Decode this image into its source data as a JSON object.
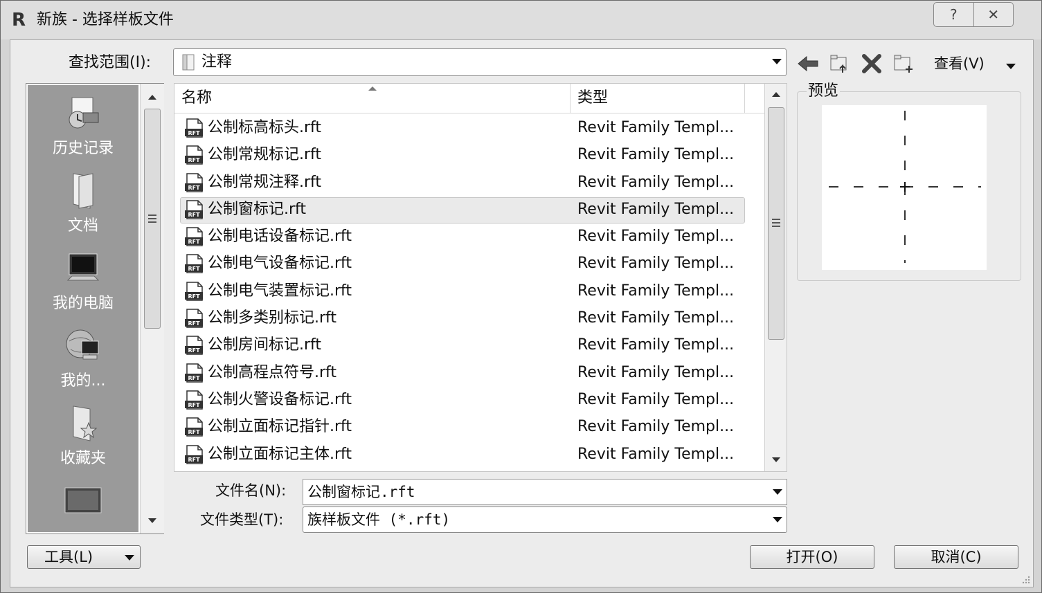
{
  "window": {
    "title": "新族 - 选择样板文件",
    "app_icon": "R",
    "help_glyph": "?",
    "close_glyph": "✕"
  },
  "lookin": {
    "label": "查找范围(I):",
    "value": "注释"
  },
  "toolbar": {
    "view_label": "查看(V)",
    "icons": [
      "back-arrow-icon",
      "up-folder-icon",
      "delete-icon",
      "new-folder-icon"
    ]
  },
  "places": [
    {
      "label": "历史记录",
      "icon": "history-icon"
    },
    {
      "label": "文档",
      "icon": "documents-icon"
    },
    {
      "label": "我的电脑",
      "icon": "computer-icon"
    },
    {
      "label": "我的...",
      "icon": "network-icon"
    },
    {
      "label": "收藏夹",
      "icon": "favorites-icon"
    },
    {
      "label": "",
      "icon": "desktop-icon"
    }
  ],
  "filelist": {
    "columns": [
      "名称",
      "类型"
    ],
    "selected_index": 3,
    "rows": [
      {
        "name": "公制标高标头.rft",
        "type": "Revit Family Templ..."
      },
      {
        "name": "公制常规标记.rft",
        "type": "Revit Family Templ..."
      },
      {
        "name": "公制常规注释.rft",
        "type": "Revit Family Templ..."
      },
      {
        "name": "公制窗标记.rft",
        "type": "Revit Family Templ..."
      },
      {
        "name": "公制电话设备标记.rft",
        "type": "Revit Family Templ..."
      },
      {
        "name": "公制电气设备标记.rft",
        "type": "Revit Family Templ..."
      },
      {
        "name": "公制电气装置标记.rft",
        "type": "Revit Family Templ..."
      },
      {
        "name": "公制多类别标记.rft",
        "type": "Revit Family Templ..."
      },
      {
        "name": "公制房间标记.rft",
        "type": "Revit Family Templ..."
      },
      {
        "name": "公制高程点符号.rft",
        "type": "Revit Family Templ..."
      },
      {
        "name": "公制火警设备标记.rft",
        "type": "Revit Family Templ..."
      },
      {
        "name": "公制立面标记指针.rft",
        "type": "Revit Family Templ..."
      },
      {
        "name": "公制立面标记主体.rft",
        "type": "Revit Family Templ..."
      }
    ],
    "file_icon_text": "RFT"
  },
  "preview": {
    "label": "预览"
  },
  "filename": {
    "label": "文件名(N):",
    "value": "公制窗标记.rft"
  },
  "filetype": {
    "label": "文件类型(T):",
    "value": "族样板文件 (*.rft)"
  },
  "buttons": {
    "tools": "工具(L)",
    "open": "打开(O)",
    "cancel": "取消(C)"
  }
}
